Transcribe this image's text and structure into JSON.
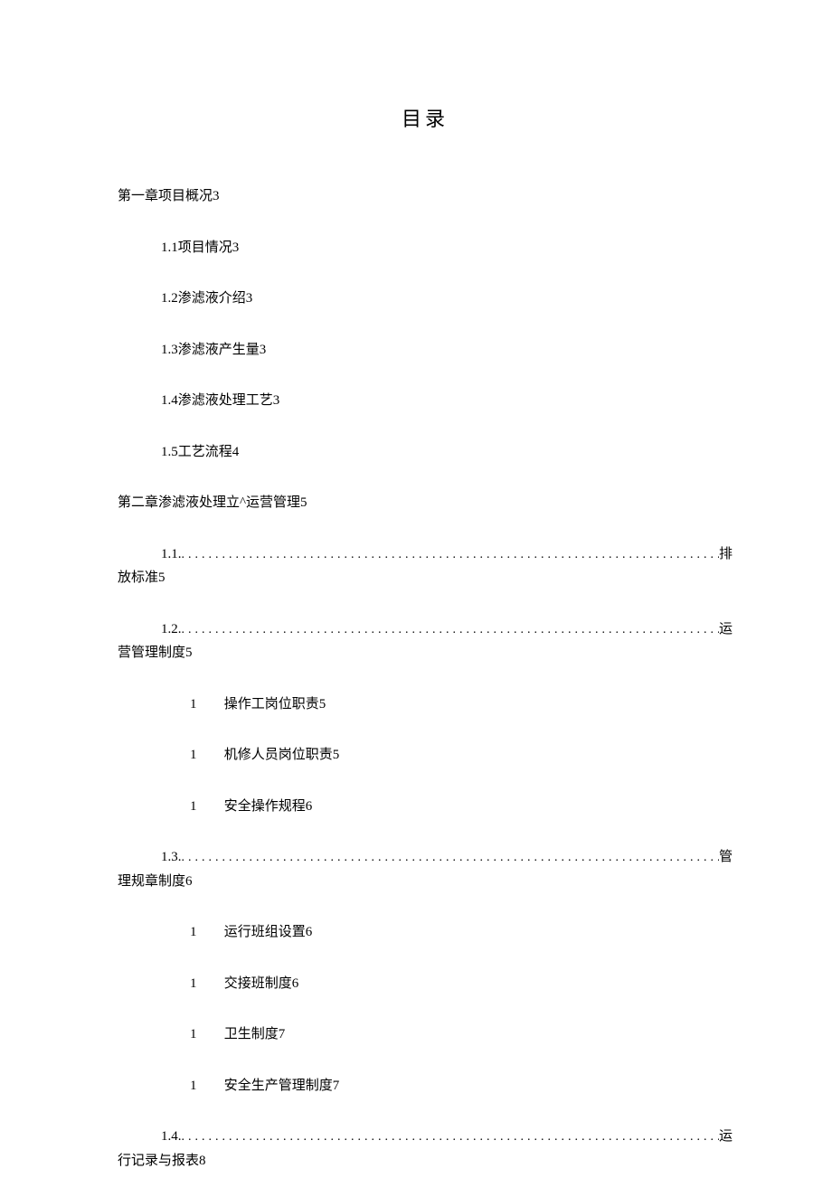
{
  "title": "目录",
  "lines": {
    "ch1": "第一章项目概况3",
    "ch1_1": "1.1项目情况3",
    "ch1_2": "1.2渗滤液介绍3",
    "ch1_3": "1.3渗滤液产生量3",
    "ch1_4": "1.4渗滤液处理工艺3",
    "ch1_5": "1.5工艺流程4",
    "ch2": "第二章渗滤液处理立^运营管理5",
    "s1_1_prefix": "1.1.",
    "s1_1_suffix": "排",
    "s1_1_cont": "放标准5",
    "s1_2_prefix": "1.2.",
    "s1_2_suffix": "运",
    "s1_2_cont": "营管理制度5",
    "sub_num": "1",
    "sub_a": "操作工岗位职责5",
    "sub_b": "机修人员岗位职责5",
    "sub_c": "安全操作规程6",
    "s1_3_prefix": "1.3.",
    "s1_3_suffix": "管",
    "s1_3_cont": "理规章制度6",
    "sub_d": "运行班组设置6",
    "sub_e": "交接班制度6",
    "sub_f": "卫生制度7",
    "sub_g": "安全生产管理制度7",
    "s1_4_prefix": "1.4.",
    "s1_4_suffix": "运",
    "s1_4_cont": "行记录与报表8"
  },
  "leader_dots": ".................................................................................................."
}
